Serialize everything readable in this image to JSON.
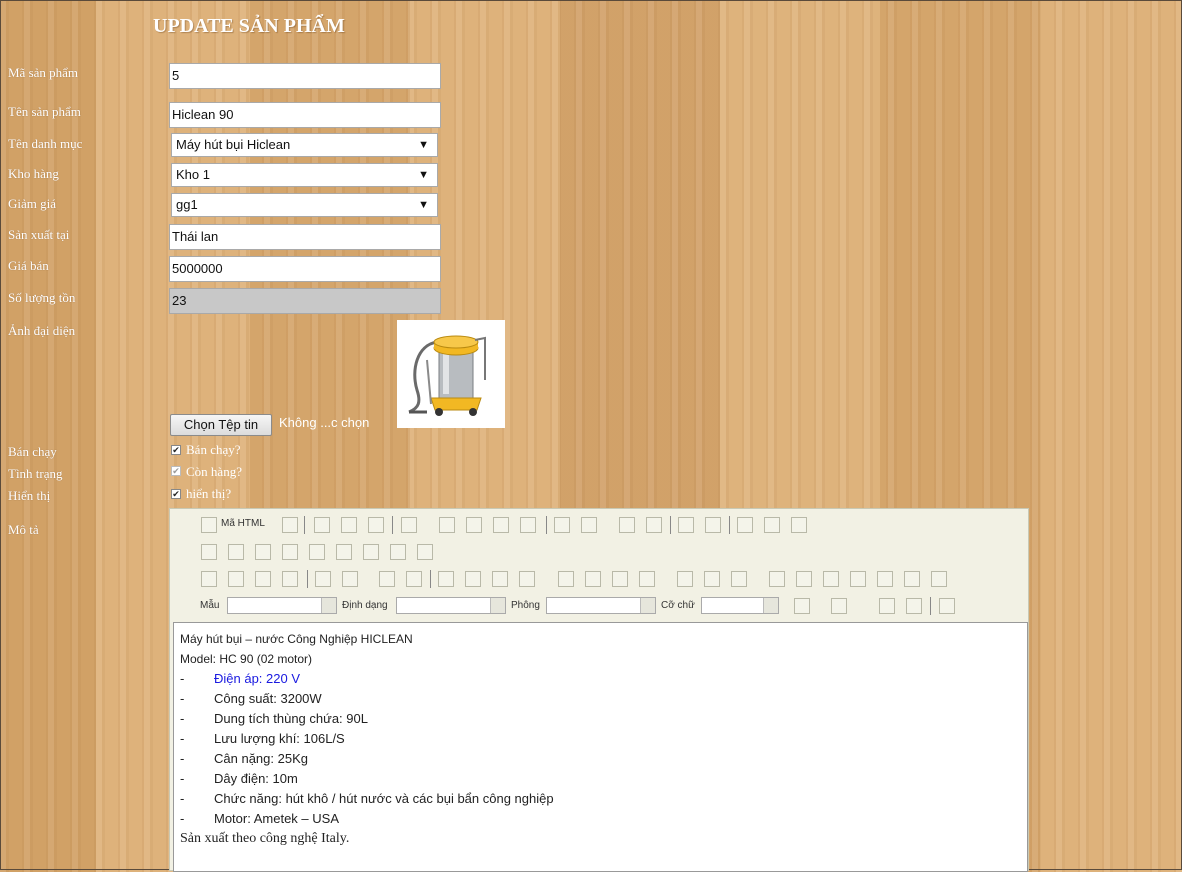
{
  "title": "UPDATE SẢN PHẨM",
  "labels": {
    "ma_sp": "Mã sản phẩm",
    "ten_sp": "Tên sản phẩm",
    "ten_dm": "Tên danh mục",
    "kho": "Kho hàng",
    "giam_gia": "Giảm giá",
    "san_xuat": "Sản xuất tại",
    "gia_ban": "Giá bán",
    "so_luong": "Số lượng tồn",
    "anh": "Ảnh đại diện",
    "ban_chay": "Bán chạy",
    "tinh_trang": "Tình trạng",
    "hien_thi": "Hiển thị",
    "mo_ta": "Mô tả"
  },
  "fields": {
    "ma_sp": "5",
    "ten_sp": "Hiclean 90",
    "ten_dm": "Máy hút bụi Hiclean",
    "kho": "Kho 1",
    "giam_gia": "gg1",
    "san_xuat": "Thái lan",
    "gia_ban": "5000000",
    "so_luong": "23"
  },
  "file": {
    "button": "Chọn Tệp tin",
    "status": "Không ...c chọn"
  },
  "checkboxes": {
    "ban_chay": {
      "label": "Bán chạy?",
      "checked": true
    },
    "con_hang": {
      "label": "Còn hàng?",
      "checked": true
    },
    "hien_thi": {
      "label": "hiển thị?",
      "checked": true
    }
  },
  "editor": {
    "source_label": "Mã HTML",
    "style_label": "Mẫu",
    "format_label": "Định dạng",
    "font_label": "Phông",
    "size_label": "Cỡ chữ",
    "content": {
      "l1": "Máy hút bụi – nước Công Nghiệp HICLEAN",
      "l2": "Model: HC 90  (02 motor)",
      "dash": "-",
      "b1": "Điện áp: 220 V",
      "b2": "Công suất: 3200W",
      "b3": "Dung tích thùng chứa: 90L",
      "b4": "Lưu lượng khí: 106L/S",
      "b5": "Cân nặng: 25Kg",
      "b6": "Dây điện: 10m",
      "b7": "Chức năng: hút khô / hút nước và các bụi bẩn công nghiệp",
      "b8": "Motor: Ametek – USA",
      "l_end": "Sản xuất theo công nghệ Italy."
    }
  }
}
